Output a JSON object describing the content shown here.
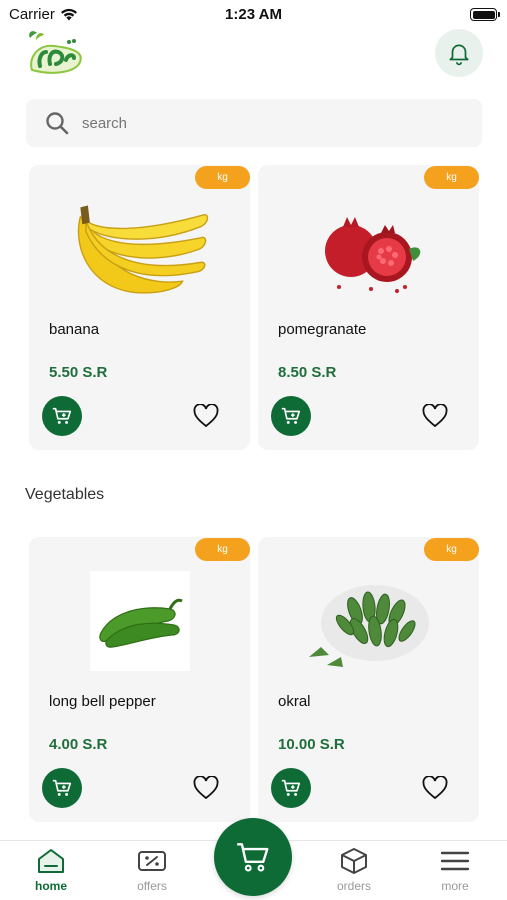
{
  "status_bar": {
    "carrier": "Carrier",
    "time": "1:23 AM"
  },
  "header": {
    "logo_icon": "brand-logo-icon",
    "notification_icon": "bell-icon"
  },
  "search": {
    "placeholder": "search",
    "icon": "search-icon"
  },
  "fruits": [
    {
      "unit": "kg",
      "name": "banana",
      "price": "5.50 S.R",
      "image_icon": "banana-image"
    },
    {
      "unit": "kg",
      "name": "pomegranate",
      "price": "8.50 S.R",
      "image_icon": "pomegranate-image"
    }
  ],
  "vegetables_section": {
    "title": "Vegetables",
    "items": [
      {
        "unit": "kg",
        "name": "long bell pepper",
        "price": "4.00 S.R",
        "image_icon": "pepper-image"
      },
      {
        "unit": "kg",
        "name": "okral",
        "price": "10.00 S.R",
        "image_icon": "okra-image"
      }
    ]
  },
  "bottom_nav": {
    "home": "home",
    "offers": "offers",
    "orders": "orders",
    "more": "more"
  },
  "colors": {
    "brand_green": "#0e6b36",
    "price_green": "#1f6e3c",
    "unit_orange": "#f4a11d",
    "card_bg": "#f5f5f5"
  }
}
